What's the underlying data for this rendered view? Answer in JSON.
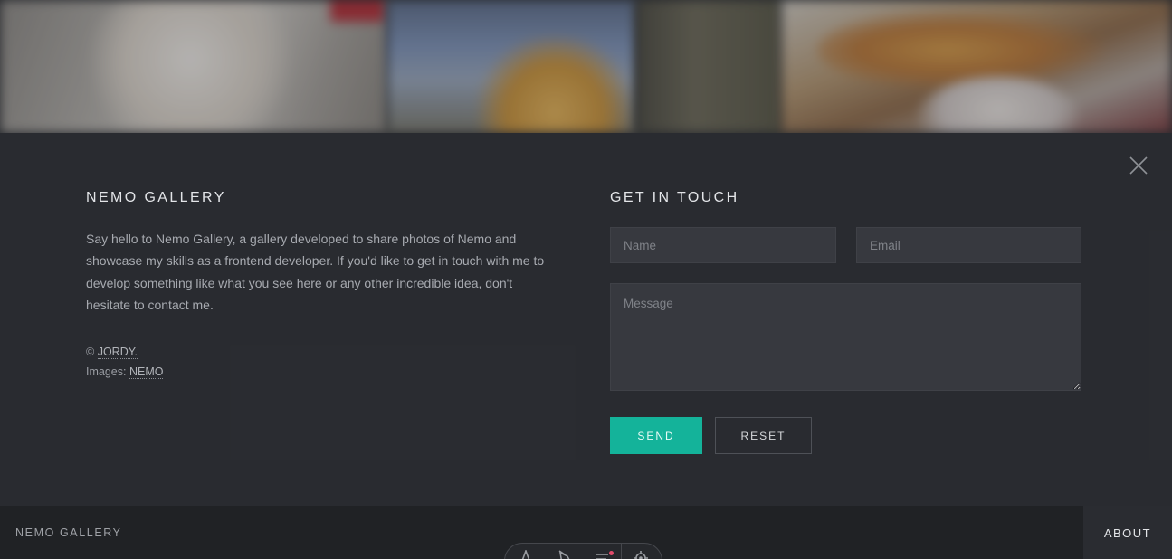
{
  "about": {
    "title": "NEMO GALLERY",
    "description": "Say hello to Nemo Gallery, a gallery developed to share photos of Nemo and showcase my skills as a frontend developer. If you'd like to get in touch with me to develop something like what you see here or any other incredible idea, don't hesitate to contact me.",
    "copyright_symbol": "©",
    "author_link": "JORDY.",
    "images_label": "Images:",
    "images_link": "NEMO"
  },
  "contact": {
    "title": "GET IN TOUCH",
    "name_placeholder": "Name",
    "email_placeholder": "Email",
    "message_placeholder": "Message",
    "send_label": "SEND",
    "reset_label": "RESET"
  },
  "footer": {
    "brand": "NEMO GALLERY",
    "about_label": "ABOUT"
  },
  "icons": {
    "close": "close-icon",
    "toolbar": [
      "pen-icon",
      "broom-icon",
      "menu-icon",
      "gear-icon"
    ]
  },
  "colors": {
    "accent": "#14b39a",
    "panel": "#2a2c31",
    "bar": "#202225",
    "notification": "#e24a6a"
  }
}
